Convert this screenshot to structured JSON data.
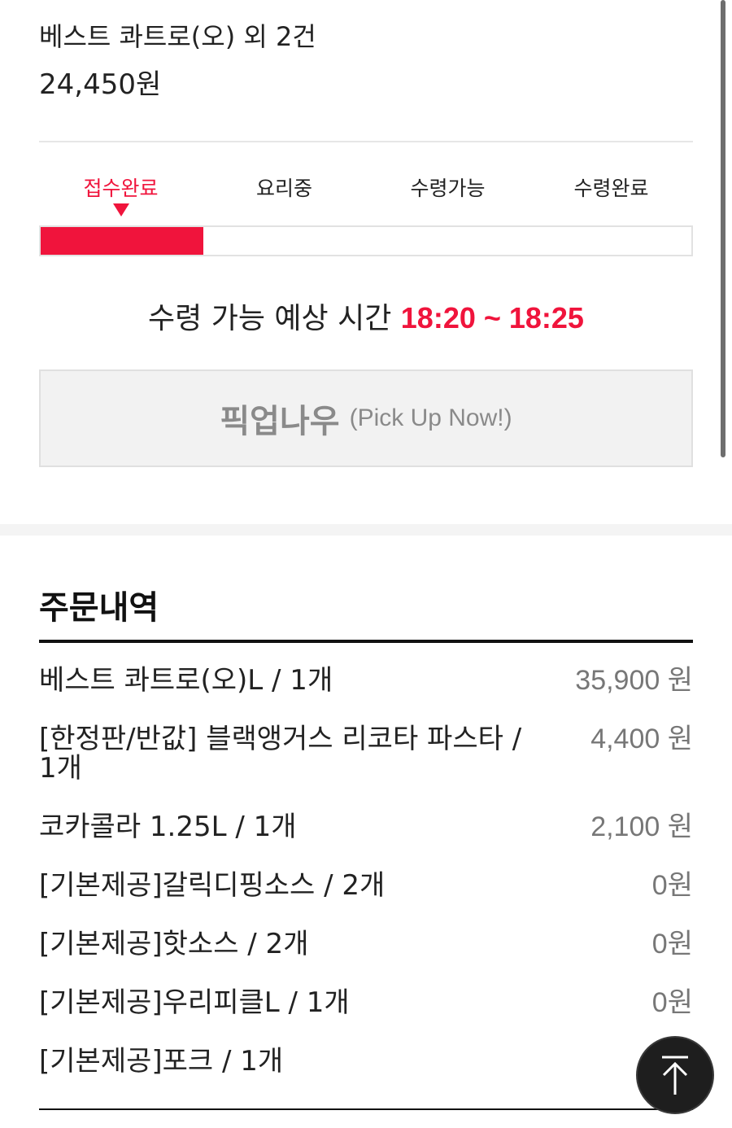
{
  "order": {
    "title": "베스트 콰트로(오) 외 2건",
    "total": "24,450원"
  },
  "progress": {
    "steps": [
      "접수완료",
      "요리중",
      "수령가능",
      "수령완료"
    ],
    "active_step": 0,
    "filled_fraction": 0.25
  },
  "eta": {
    "label": "수령 가능 예상 시간",
    "time": "18:20 ~ 18:25"
  },
  "pickup_button": {
    "label_ko": "픽업나우",
    "label_en": "(Pick Up Now!)"
  },
  "history": {
    "title": "주문내역",
    "items": [
      {
        "name": "베스트 콰트로(오)L / 1개",
        "price": "35,900 원"
      },
      {
        "name": "[한정판/반값] 블랙앵거스 리코타 파스타 / 1개",
        "price": "4,400 원"
      },
      {
        "name": "코카콜라 1.25L / 1개",
        "price": "2,100 원"
      },
      {
        "name": "[기본제공]갈릭디핑소스 / 2개",
        "price": "0원"
      },
      {
        "name": "[기본제공]핫소스 / 2개",
        "price": "0원"
      },
      {
        "name": "[기본제공]우리피클L / 1개",
        "price": "0원"
      },
      {
        "name": "[기본제공]포크 / 1개",
        "price": ""
      }
    ]
  },
  "icons": {
    "scroll_top": "arrow-up-to-top-icon",
    "step_marker": "triangle-down-icon"
  },
  "colors": {
    "accent": "#f0143c",
    "muted_text": "#777777",
    "button_bg": "#f2f2f2"
  }
}
